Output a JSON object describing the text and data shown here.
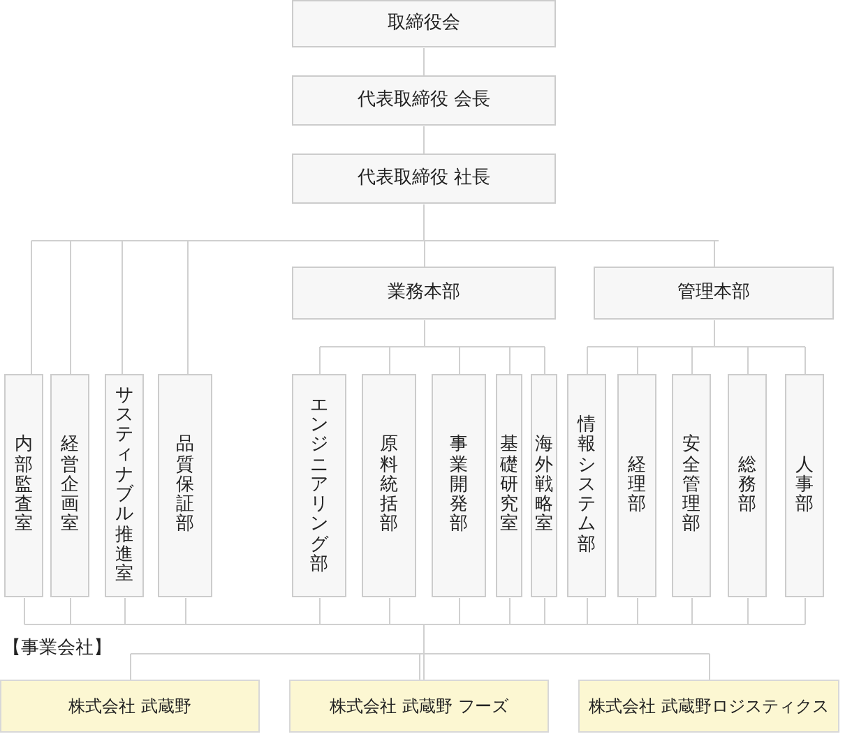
{
  "executives": [
    "取締役会",
    "代表取締役 会長",
    "代表取締役 社長"
  ],
  "staff_departments": [
    "内部監査室",
    "経営企画室",
    "サスティナブル推進室",
    "品質保証部"
  ],
  "divisions": [
    {
      "name": "業務本部",
      "departments": [
        "エンジニアリング部",
        "原料統括部",
        "事業開発部",
        "基礎研究室",
        "海外戦略室"
      ]
    },
    {
      "name": "管理本部",
      "departments": [
        "情報システム部",
        "経理部",
        "安全管理部",
        "総務部",
        "人事部"
      ]
    }
  ],
  "companies_label": "【事業会社】",
  "companies": [
    "株式会社 武蔵野",
    "株式会社 武蔵野 フーズ",
    "株式会社 武蔵野ロジスティクス"
  ]
}
